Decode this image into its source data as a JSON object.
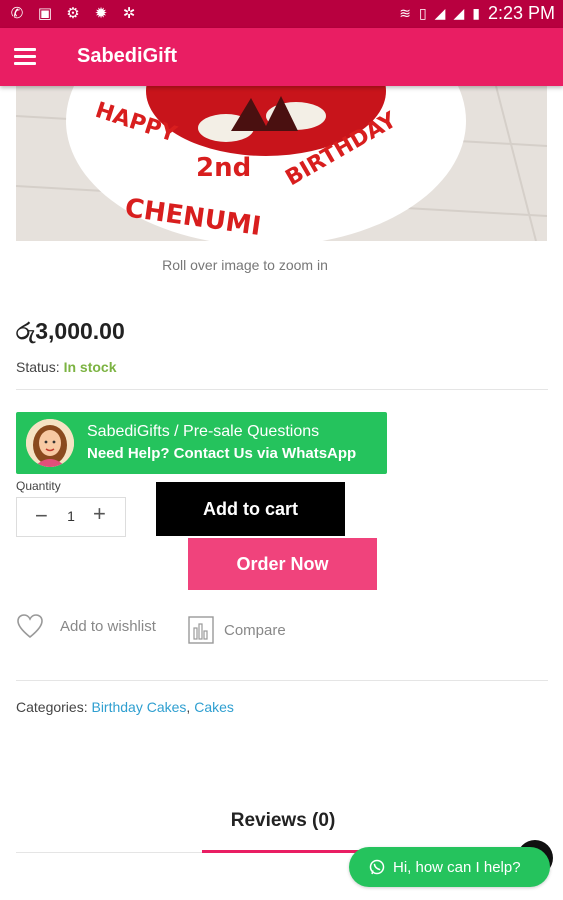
{
  "status_bar": {
    "time": "2:23 PM",
    "icons": [
      "missed-call-icon",
      "photo-icon",
      "settings-icon",
      "bug-icon",
      "vpn-icon",
      "wifi-icon",
      "sim-icon",
      "signal-icon",
      "signal-icon",
      "battery-icon"
    ]
  },
  "app_bar": {
    "title": "SabediGift",
    "menu_icon": "hamburger-icon"
  },
  "product": {
    "image_alt": "HAPPY 2nd BIRTHDAY CHENUMI",
    "zoom_hint": "Roll over image to zoom in",
    "price": "රු3,000.00",
    "status_label": "Status:",
    "status_value": "In stock"
  },
  "whatsapp_banner": {
    "line1": "SabediGifts / Pre-sale Questions",
    "line2": "Need Help? Contact Us via WhatsApp"
  },
  "quantity": {
    "label": "Quantity",
    "value": "1",
    "minus": "−",
    "plus": "+"
  },
  "buttons": {
    "add_to_cart": "Add to cart",
    "order_now": "Order Now"
  },
  "actions": {
    "wishlist": "Add to wishlist",
    "compare": "Compare"
  },
  "categories": {
    "label": "Categories:",
    "items": [
      "Birthday Cakes",
      "Cakes"
    ]
  },
  "tabs": {
    "reviews": "Reviews (0)"
  },
  "chat": {
    "label": "Hi, how can I help?"
  },
  "colors": {
    "status_bar": "#b8003f",
    "app_bar": "#e91e63",
    "in_stock": "#7cb342",
    "whatsapp": "#25c35d",
    "order_now": "#f0437c",
    "link": "#2f9fd0"
  }
}
